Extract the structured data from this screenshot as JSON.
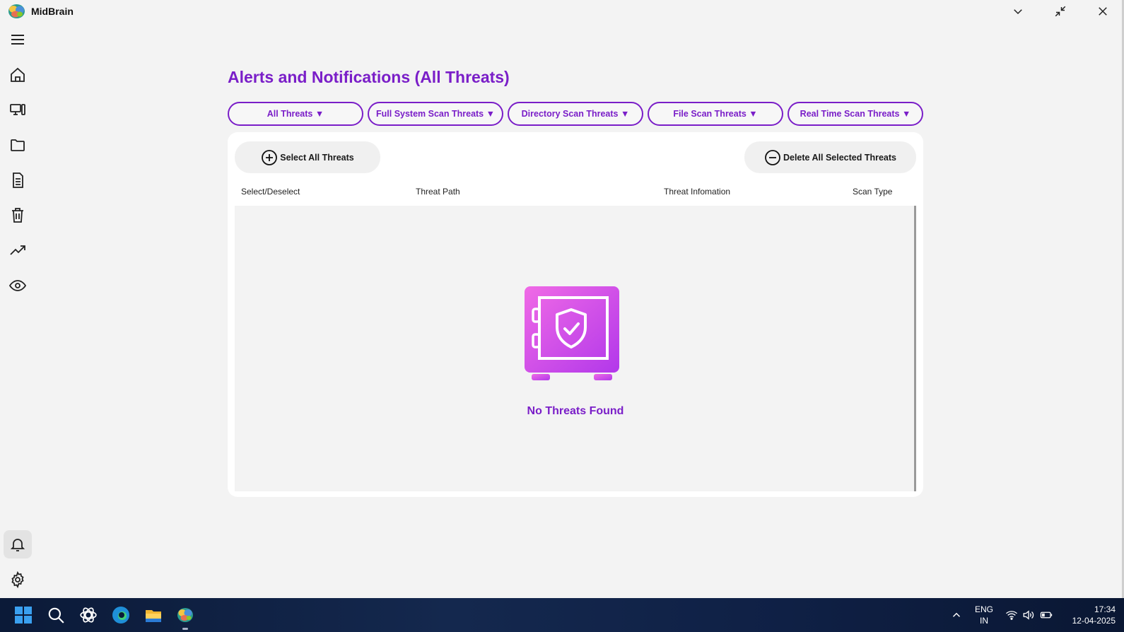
{
  "app": {
    "title": "MidBrain"
  },
  "colors": {
    "accent": "#7a1ec8",
    "illustration_start": "#f06ae6",
    "illustration_end": "#b238ea"
  },
  "sidebar": {
    "items": [
      {
        "name": "menu",
        "icon": "hamburger-menu-icon"
      },
      {
        "name": "home",
        "icon": "home-icon"
      },
      {
        "name": "devices",
        "icon": "devices-icon"
      },
      {
        "name": "folder",
        "icon": "folder-icon"
      },
      {
        "name": "document",
        "icon": "document-icon"
      },
      {
        "name": "trash",
        "icon": "trash-icon"
      },
      {
        "name": "trending",
        "icon": "trending-up-icon"
      },
      {
        "name": "eye",
        "icon": "eye-icon"
      },
      {
        "name": "notifications",
        "icon": "bell-icon",
        "active": true
      },
      {
        "name": "settings",
        "icon": "gear-icon"
      }
    ]
  },
  "main": {
    "title": "Alerts and Notifications (All Threats)",
    "filters": [
      {
        "label": "All Threats ▼"
      },
      {
        "label": "Full System Scan Threats ▼"
      },
      {
        "label": "Directory Scan Threats ▼"
      },
      {
        "label": "File Scan Threats ▼"
      },
      {
        "label": "Real Time Scan Threats ▼"
      }
    ],
    "select_all_label": "Select All Threats",
    "delete_selected_label": "Delete All Selected Threats",
    "columns": [
      "Select/Deselect",
      "Threat Path",
      "Threat Infomation",
      "Scan Type"
    ],
    "empty_message": "No Threats Found"
  },
  "taskbar": {
    "apps": [
      "windows-start-icon",
      "search-icon",
      "chatgpt-icon",
      "edge-browser-icon",
      "file-explorer-icon",
      "midbrain-app-icon"
    ],
    "tray": {
      "language_line1": "ENG",
      "language_line2": "IN",
      "time": "17:34",
      "date": "12-04-2025"
    }
  }
}
